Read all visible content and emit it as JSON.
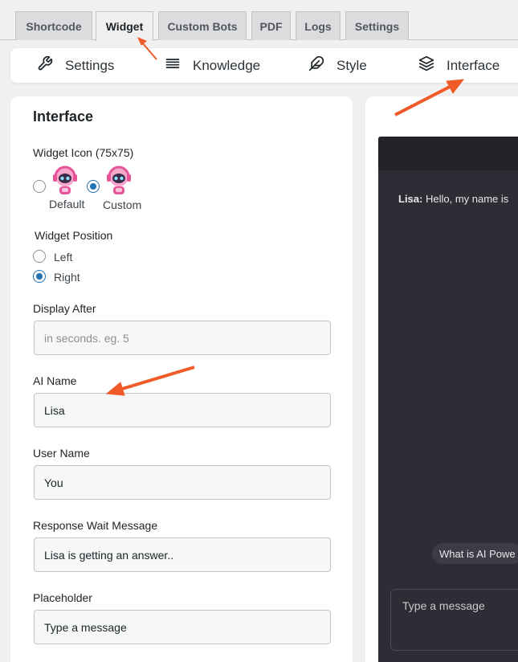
{
  "tabs": [
    "Shortcode",
    "Widget",
    "Custom Bots",
    "PDF",
    "Logs",
    "Settings"
  ],
  "subnav": {
    "settings": "Settings",
    "knowledge": "Knowledge",
    "style": "Style",
    "interface": "Interface"
  },
  "panel": {
    "title": "Interface",
    "widget_icon": {
      "label": "Widget Icon (75x75)",
      "options": [
        "Default",
        "Custom"
      ],
      "selected": "Custom"
    },
    "widget_position": {
      "label": "Widget Position",
      "options": [
        "Left",
        "Right"
      ],
      "selected": "Right"
    },
    "display_after": {
      "label": "Display After",
      "value": "",
      "placeholder": "in seconds. eg. 5"
    },
    "ai_name": {
      "label": "AI Name",
      "value": "Lisa"
    },
    "user_name": {
      "label": "User Name",
      "value": "You"
    },
    "wait_message": {
      "label": "Response Wait Message",
      "value": "Lisa is getting an answer.."
    },
    "placeholder": {
      "label": "Placeholder",
      "value": "Type a message"
    }
  },
  "preview": {
    "ai_label": "Lisa:",
    "greeting": "Hello, my name is",
    "chip": "What is AI Powe",
    "input_placeholder": "Type a message"
  },
  "colors": {
    "accent": "#2271b1",
    "annotation_arrow": "#f05a28",
    "chat_bg": "#2c2d35",
    "robot_pink": "#e8549a"
  },
  "icons": [
    "wrench-icon",
    "list-icon",
    "feather-icon",
    "layers-icon",
    "robot-icon"
  ]
}
